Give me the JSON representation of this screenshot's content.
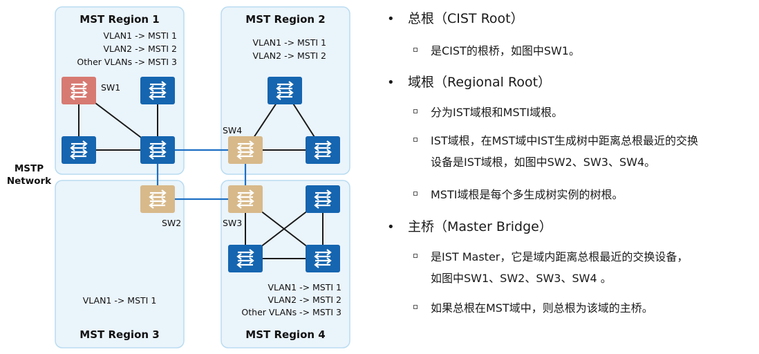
{
  "network_label": [
    "MSTP",
    "Network"
  ],
  "regions": [
    {
      "title": "MST Region 1",
      "mappings": [
        "VLAN1 -> MSTI 1",
        "VLAN2 -> MSTI 2",
        "Other VLANs -> MSTI 3"
      ]
    },
    {
      "title": "MST Region 2",
      "mappings": [
        "VLAN1 -> MSTI 1",
        "VLAN2 -> MSTI 2"
      ]
    },
    {
      "title": "MST Region 3",
      "mappings": [
        "VLAN1 -> MSTI 1"
      ]
    },
    {
      "title": "MST Region 4",
      "mappings": [
        "VLAN1 -> MSTI 1",
        "VLAN2 -> MSTI 2",
        "Other VLANs -> MSTI 3"
      ]
    }
  ],
  "switch_labels": {
    "sw1": "SW1",
    "sw2": "SW2",
    "sw3": "SW3",
    "sw4": "SW4"
  },
  "colors": {
    "region_fill": "#eaf4fb",
    "region_border": "#b9dcf1",
    "blue_switch": "#1565b0",
    "cist_root": "#d77a72",
    "regional_root": "#d8b98a",
    "link_blue": "#1e6fc4",
    "link_black": "#1a1a1a"
  },
  "notes": [
    {
      "title": "总根（CIST Root）",
      "items": [
        "是CIST的根桥，如图中SW1。"
      ]
    },
    {
      "title": "域根（Regional Root）",
      "items": [
        "分为IST域根和MSTI域根。",
        [
          "IST域根，在MST域中IST生成树中距离总根最近的交换",
          "设备是IST域根，如图中SW2、SW3、SW4。"
        ],
        "MSTI域根是每个多生成树实例的树根。"
      ]
    },
    {
      "title": "主桥（Master Bridge）",
      "items": [
        [
          "是IST Master，它是域内距离总根最近的交换设备，",
          "如图中SW1、SW2、SW3、SW4 。"
        ],
        "如果总根在MST域中，则总根为该域的主桥。"
      ]
    }
  ]
}
